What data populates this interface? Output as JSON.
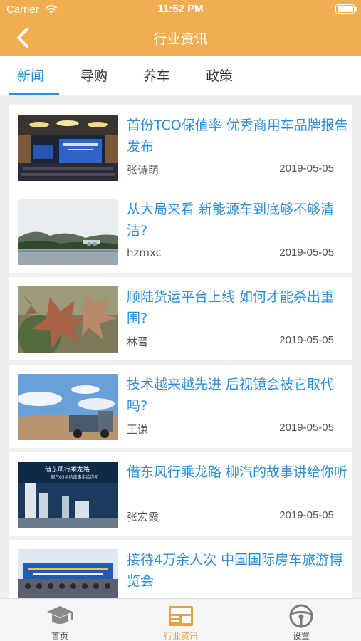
{
  "status_bar": {
    "carrier": "Carrier",
    "time": "11:52 PM"
  },
  "nav": {
    "title": "行业资讯"
  },
  "tabs": [
    {
      "label": "新闻",
      "active": true
    },
    {
      "label": "导购",
      "active": false
    },
    {
      "label": "养车",
      "active": false
    },
    {
      "label": "政策",
      "active": false
    }
  ],
  "articles": [
    {
      "title": "首份TCO保值率 优秀商用车品牌报告发布",
      "author": "张诗萌",
      "date": "2019-05-05",
      "image": "conference-hall-photo"
    },
    {
      "title": "从大局来看 新能源车到底够不够清洁?",
      "author": "hzmxc",
      "date": "2019-05-05",
      "image": "lake-landscape-photo"
    },
    {
      "title": "顺陆货运平台上线 如何才能杀出重围?",
      "author": "林晋",
      "date": "2019-05-05",
      "image": "maple-leaves-photo"
    },
    {
      "title": "技术越来越先进 后视镜会被它取代吗?",
      "author": "王谦",
      "date": "2019-05-05",
      "image": "rally-truck-photo"
    },
    {
      "title": "借东风行乘龙路 柳汽的故事讲给你听",
      "author": "张宏霞",
      "date": "2019-05-05",
      "image": "city-poster-photo",
      "thumb_heading": "借东风行乘龙路",
      "thumb_subheading": "柳汽65年的故事讲给你听"
    },
    {
      "title": "接待4万余人次 中国国际房车旅游博览会",
      "author": "",
      "date": "",
      "image": "expo-crowd-photo"
    }
  ],
  "bottom_nav": [
    {
      "label": "首页",
      "icon": "graduation-cap-icon",
      "active": false
    },
    {
      "label": "行业资讯",
      "icon": "newspaper-icon",
      "active": true
    },
    {
      "label": "设置",
      "icon": "steering-wheel-icon",
      "active": false
    }
  ],
  "colors": {
    "header": "#f0ad52",
    "accent": "#2b8ed6",
    "active_nav": "#e8a04a"
  }
}
